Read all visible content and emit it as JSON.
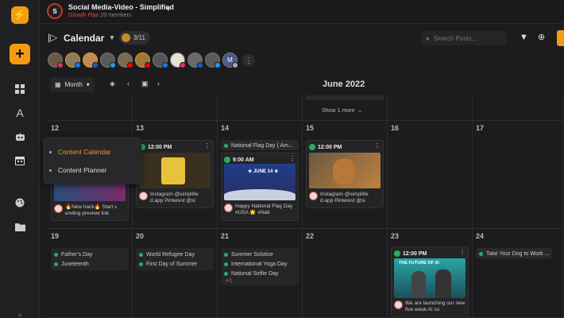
{
  "workspace": {
    "initial": "S",
    "title": "Social Media-Video - Simplified",
    "plan": "Growth Plan",
    "members": "20 members"
  },
  "header": {
    "title": "Calendar",
    "count": "3/11",
    "search_placeholder": "Search Posts..."
  },
  "toolbar": {
    "view_label": "Month",
    "month_title": "June 2022"
  },
  "menu": {
    "items": [
      "Content Calendar",
      "Content Planner"
    ]
  },
  "calendar": {
    "show_more": "Show 1 more",
    "day12": "12",
    "day13": "13",
    "day14": "14",
    "day15": "15",
    "day16": "16",
    "day17": "17",
    "day19": "19",
    "day20": "20",
    "day21": "21",
    "day22": "22",
    "day23": "23",
    "day24": "24",
    "cap12": "🔥New hack🔥 Start s ending preview link",
    "time13": "12:00 PM",
    "cap13": "Instagram @simplifie d.app Pinterest @si",
    "evt14": "National Flag Day ( Am...",
    "time14": "9:00 AM",
    "cap14": "Happy National Flag Day #USA 🌟 #Nati",
    "flag_text": "★ JUNE 14 ★",
    "time15": "12:00 PM",
    "cap15": "Instagram @simplifie d.app Pinterest @si",
    "evt19": [
      "Father's Day",
      "Juneteenth"
    ],
    "evt20": [
      "World Refugee Day",
      "First Day of Summer"
    ],
    "evt21": [
      "Summer Solstice",
      "International Yoga Day",
      "National Selfie Day"
    ],
    "more21": "+1",
    "time23": "12:00 PM",
    "img23_title": "THE FUTURE OF AI",
    "cap23": "We are launching our new five week AI co",
    "evt24": "Take Your Dog to Work ..."
  },
  "colors": {
    "accent": "#f39c12",
    "event_dot": "#27ae60",
    "plan": "#e74c3c"
  }
}
